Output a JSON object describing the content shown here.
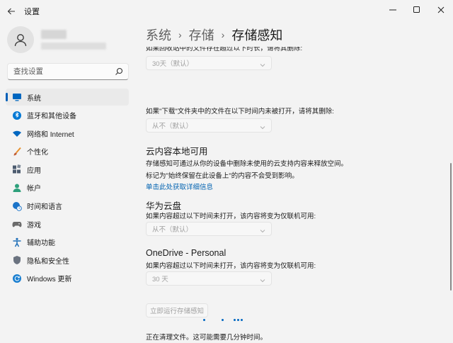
{
  "window": {
    "title": "设置",
    "back_icon": "back-arrow-icon",
    "controls": [
      "minimize-icon",
      "maximize-icon",
      "close-icon"
    ]
  },
  "search": {
    "placeholder": "查找设置"
  },
  "sidebar": {
    "items": [
      {
        "label": "系统",
        "icon": "monitor-icon",
        "color": "#0067c0",
        "selected": true
      },
      {
        "label": "蓝牙和其他设备",
        "icon": "bluetooth-icon",
        "color": "#0078d4",
        "selected": false
      },
      {
        "label": "网络和 Internet",
        "icon": "wifi-icon",
        "color": "#0067c0",
        "selected": false
      },
      {
        "label": "个性化",
        "icon": "brush-icon",
        "color": "#e8912d",
        "selected": false
      },
      {
        "label": "应用",
        "icon": "apps-icon",
        "color": "#4c5b6f",
        "selected": false
      },
      {
        "label": "帐户",
        "icon": "account-icon",
        "color": "#2ea07b",
        "selected": false
      },
      {
        "label": "时间和语言",
        "icon": "globe-clock-icon",
        "color": "#1a73c8",
        "selected": false
      },
      {
        "label": "游戏",
        "icon": "gamepad-icon",
        "color": "#6b6b6b",
        "selected": false
      },
      {
        "label": "辅助功能",
        "icon": "accessibility-icon",
        "color": "#1f6fb8",
        "selected": false
      },
      {
        "label": "隐私和安全性",
        "icon": "shield-icon",
        "color": "#6b7380",
        "selected": false
      },
      {
        "label": "Windows 更新",
        "icon": "update-icon",
        "color": "#1a7fd0",
        "selected": false
      }
    ]
  },
  "breadcrumb": {
    "items": [
      "系统",
      "存储"
    ],
    "current": "存储感知"
  },
  "content": {
    "recycle_cut": "如果回收站中的文件存在超过以下时长，请将其删除:",
    "recycle_dropdown": "30天（默认）",
    "downloads_label": "如果\"下载\"文件夹中的文件在以下时间内未被打开，请将其删除:",
    "downloads_dropdown": "从不（默认）",
    "cloud_title": "云内容本地可用",
    "cloud_desc1": "存储感知可通过从你的设备中删除未使用的云支持内容来释放空间。",
    "cloud_desc2": "标记为\"始终保留在此设备上\"的内容不会受到影响。",
    "cloud_link": "单击此处获取详细信息",
    "huawei_title": "华为云盘",
    "huawei_desc": "如果内容超过以下时间未打开，该内容将变为仅联机可用:",
    "huawei_dropdown": "从不（默认）",
    "onedrive_title": "OneDrive - Personal",
    "onedrive_desc": "如果内容超过以下时间未打开，该内容将变为仅联机可用:",
    "onedrive_dropdown": "30 天",
    "run_button": "立即运行存储感知",
    "status": "正在清理文件。这可能需要几分钟时间。"
  },
  "colors": {
    "accent": "#005fb8",
    "link": "#0062b1",
    "background": "#f3f3f3"
  }
}
